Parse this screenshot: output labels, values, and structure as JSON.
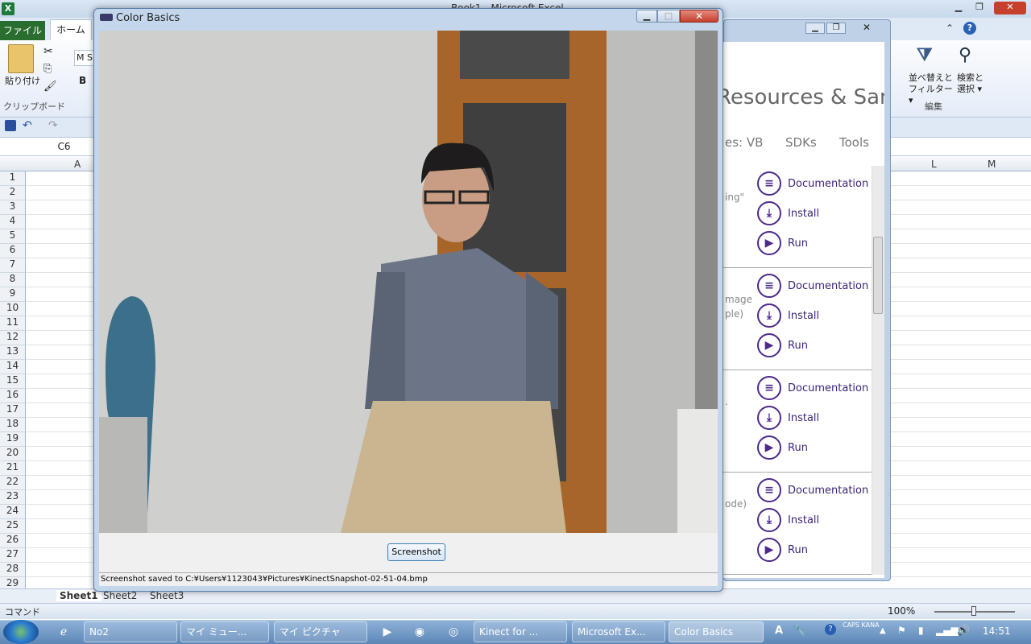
{
  "excel": {
    "title": "Book1 - Microsoft Excel",
    "tabs": {
      "file": "ファイル",
      "home": "ホーム"
    },
    "ribbon": {
      "paste": "貼り付け",
      "clipboard_group": "クリップボード",
      "font_name": "M S",
      "bold": "B",
      "sort_filter": "並べ替えと フィルター ▾",
      "find_select": "検索と 選択 ▾",
      "edit_group": "編集"
    },
    "name_box": "C6",
    "columns": {
      "a": "A",
      "l": "L",
      "m": "M"
    },
    "rows": [
      "1",
      "2",
      "3",
      "4",
      "5",
      "6",
      "7",
      "8",
      "9",
      "10",
      "11",
      "12",
      "13",
      "14",
      "15",
      "16",
      "17",
      "18",
      "19",
      "20",
      "21",
      "22",
      "23",
      "24",
      "25",
      "26",
      "27",
      "28",
      "29"
    ],
    "sheets": [
      "Sheet1",
      "Sheet2",
      "Sheet3"
    ],
    "status_mode": "コマンド",
    "zoom": "100%"
  },
  "kinect_browser": {
    "heading": "Resources & Samples",
    "nav": [
      "es: VB",
      "SDKs",
      "Tools"
    ],
    "groups": [
      {
        "fragment": "ing\"",
        "fragment2": ""
      },
      {
        "fragment": "mage",
        "fragment2": "ple)"
      },
      {
        "fragment": ".",
        "fragment2": ""
      },
      {
        "fragment": "ode)",
        "fragment2": ""
      }
    ],
    "actions": {
      "documentation": "Documentation",
      "install": "Install",
      "run": "Run"
    }
  },
  "color_basics": {
    "title": "Color Basics",
    "minimize": "▁",
    "maximize": "□",
    "close": "✕",
    "screenshot_button": "Screenshot",
    "status": "Screenshot saved to C:¥Users¥1123043¥Pictures¥KinectSnapshot-02-51-04.bmp"
  },
  "taskbar": {
    "buttons": [
      "No2",
      "マイ ミュー...",
      "マイ ピクチャ",
      "Kinect for ...",
      "Microsoft Ex...",
      "Color Basics"
    ],
    "ime": "A",
    "caps": "CAPS KANA",
    "clock": "14:51"
  }
}
